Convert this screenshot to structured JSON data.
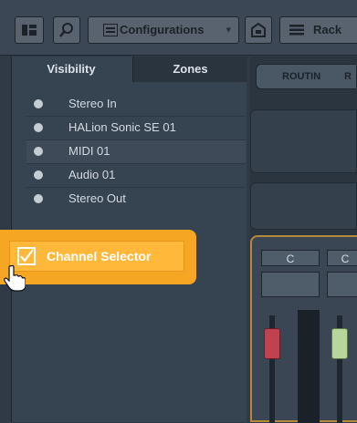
{
  "toolbar": {
    "configurations_label": "Configurations",
    "rack_label": "Rack",
    "icons": [
      "layout-icon",
      "search-icon",
      "list-icon",
      "chevron-down-icon",
      "preset-icon",
      "menu-icon"
    ]
  },
  "left_panel": {
    "tabs": [
      {
        "label": "Visibility",
        "active": true
      },
      {
        "label": "Zones",
        "active": false
      }
    ],
    "items": [
      {
        "label": "Stereo In",
        "selected": false
      },
      {
        "label": "HALion Sonic SE 01",
        "selected": false
      },
      {
        "label": "MIDI 01",
        "selected": true
      },
      {
        "label": "Audio 01",
        "selected": false
      },
      {
        "label": "Stereo Out",
        "selected": false
      }
    ],
    "channel_selector": {
      "label": "Channel Selector",
      "checked": true
    }
  },
  "right_panel": {
    "routing_label": "ROUTIN",
    "routing_label_cut": "R",
    "channels": [
      {
        "label": "C",
        "fader_color": "#c0414f"
      },
      {
        "label": "C",
        "fader_color": "#b6d69b"
      }
    ]
  },
  "colors": {
    "accent": "#f5a623",
    "panel_bg": "#364350",
    "toolbar_bg": "#3b4754"
  }
}
